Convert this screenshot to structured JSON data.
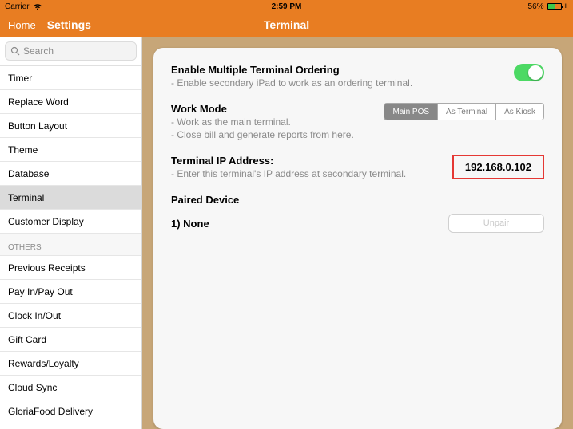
{
  "status": {
    "carrier": "Carrier",
    "time": "2:59 PM",
    "battery": "56%"
  },
  "nav": {
    "home": "Home",
    "settings": "Settings",
    "title": "Terminal"
  },
  "search": {
    "placeholder": "Search"
  },
  "sidebar": {
    "group1": [
      {
        "label": "Timer"
      },
      {
        "label": "Replace Word"
      },
      {
        "label": "Button Layout"
      },
      {
        "label": "Theme"
      },
      {
        "label": "Database"
      },
      {
        "label": "Terminal",
        "selected": true
      },
      {
        "label": "Customer Display"
      }
    ],
    "others_header": "OTHERS",
    "group2": [
      {
        "label": "Previous Receipts"
      },
      {
        "label": "Pay In/Pay Out"
      },
      {
        "label": "Clock In/Out"
      },
      {
        "label": "Gift Card"
      },
      {
        "label": "Rewards/Loyalty"
      },
      {
        "label": "Cloud Sync"
      },
      {
        "label": "GloriaFood Delivery"
      }
    ]
  },
  "panel": {
    "enable_title": "Enable Multiple Terminal Ordering",
    "enable_sub": "- Enable secondary iPad to work as an ordering terminal.",
    "workmode_title": "Work Mode",
    "workmode_sub1": "- Work as the main terminal.",
    "workmode_sub2": "- Close bill and generate reports from here.",
    "seg": [
      "Main POS",
      "As Terminal",
      "As Kiosk"
    ],
    "ip_title": "Terminal IP Address:",
    "ip_sub": "- Enter this terminal's IP address at secondary terminal.",
    "ip_value": "192.168.0.102",
    "paired_title": "Paired Device",
    "paired_item": "1) None",
    "unpair": "Unpair"
  }
}
